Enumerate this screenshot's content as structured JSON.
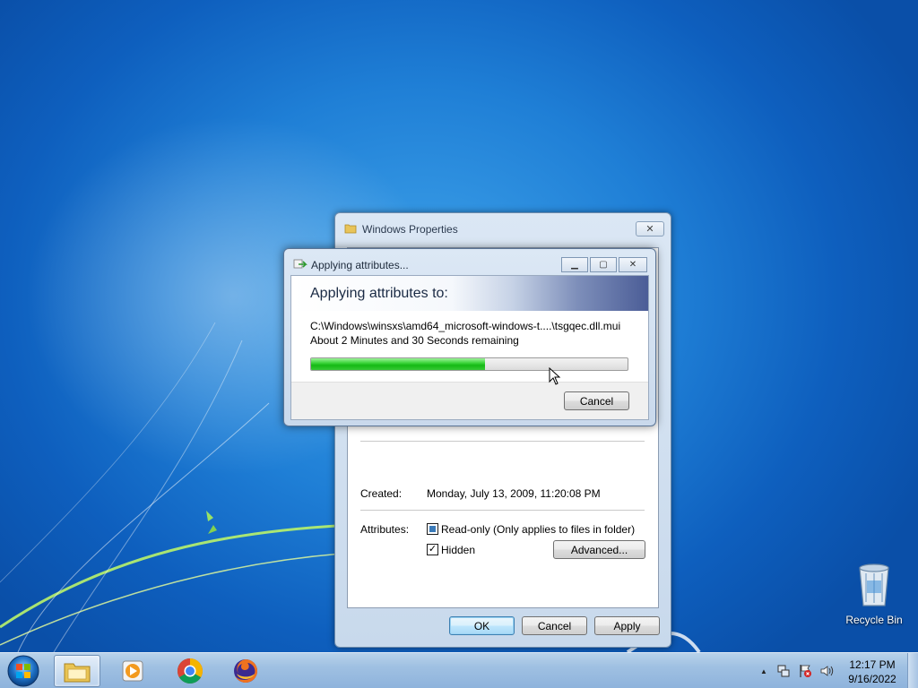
{
  "desktop": {
    "recycle_bin_label": "Recycle Bin"
  },
  "properties_dialog": {
    "title": "Windows Properties",
    "close_symbol": "✕",
    "created_label": "Created:",
    "created_value": "Monday, July 13, 2009, 11:20:08 PM",
    "attributes_label": "Attributes:",
    "readonly_label": "Read-only (Only applies to files in folder)",
    "readonly_state": "partial",
    "hidden_label": "Hidden",
    "hidden_state": "checked",
    "hidden_check_symbol": "✓",
    "advanced_button": "Advanced...",
    "ok_button": "OK",
    "cancel_button": "Cancel",
    "apply_button": "Apply"
  },
  "apply_dialog": {
    "title": "Applying attributes...",
    "header": "Applying attributes to:",
    "current_path": "C:\\Windows\\winsxs\\amd64_microsoft-windows-t....\\tsgqec.dll.mui",
    "time_remaining": "About 2 Minutes and 30 Seconds remaining",
    "progress_percent": 55,
    "cancel_button": "Cancel",
    "minimize_symbol": "▁",
    "maximize_symbol": "▢",
    "close_symbol": "✕"
  },
  "taskbar": {
    "items": [
      {
        "name": "windows-explorer",
        "icon": "folder-icon",
        "active": true
      },
      {
        "name": "windows-media-player",
        "icon": "media-player-icon",
        "active": false
      },
      {
        "name": "google-chrome",
        "icon": "chrome-icon",
        "active": false
      },
      {
        "name": "firefox",
        "icon": "firefox-icon",
        "active": false
      }
    ],
    "tray_arrow": "▲",
    "time": "12:17 PM",
    "date": "9/16/2022"
  },
  "colors": {
    "progress_green": "#15b915",
    "desktop_blue": "#1f7fd6",
    "taskbar": "#9fc0e2"
  }
}
